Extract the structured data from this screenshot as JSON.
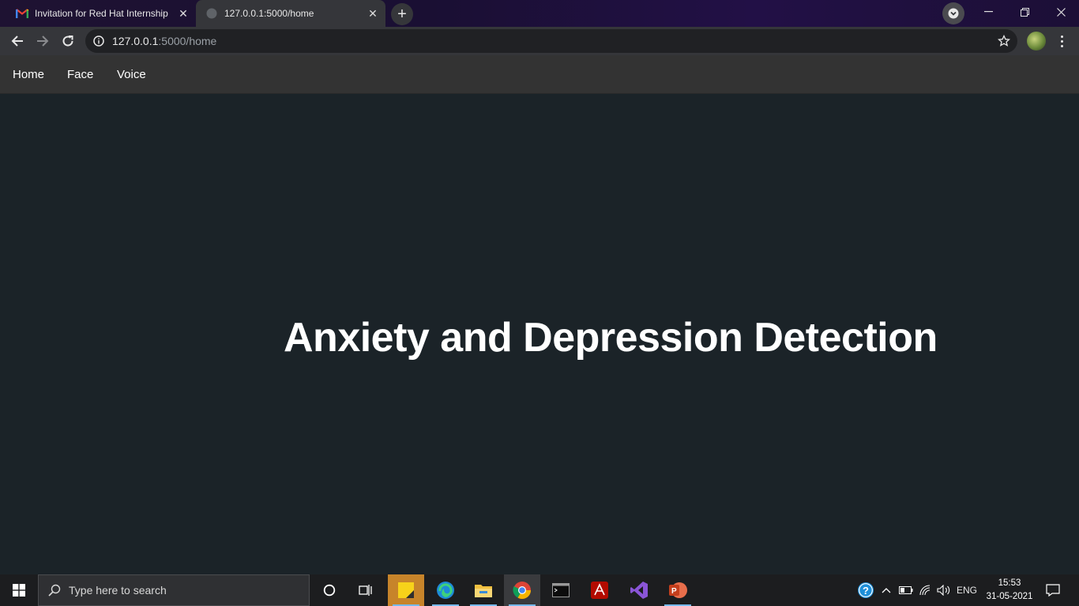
{
  "browser": {
    "tabs": [
      {
        "title": "Invitation for Red Hat Internship",
        "favicon": "gmail-icon"
      },
      {
        "title": "127.0.0.1:5000/home",
        "favicon": "globe-icon"
      }
    ],
    "address": {
      "host": "127.0.0.1",
      "path": ":5000/home"
    }
  },
  "page": {
    "nav": {
      "home": "Home",
      "face": "Face",
      "voice": "Voice"
    },
    "headline": "Anxiety and Depression Detection"
  },
  "taskbar": {
    "search_placeholder": "Type here to search",
    "language": "ENG",
    "time": "15:53",
    "date": "31-05-2021"
  },
  "colors": {
    "page_bg": "#1b2328",
    "nav_bg": "#333333",
    "headline": "#ffffff"
  }
}
